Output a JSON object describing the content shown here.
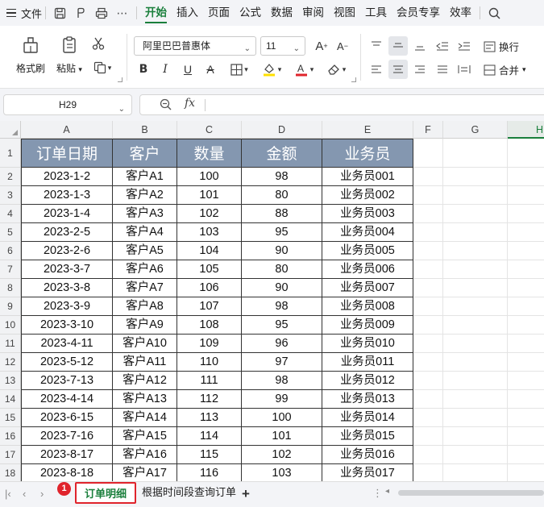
{
  "menubar": {
    "file": "文件",
    "tabs": [
      "开始",
      "插入",
      "页面",
      "公式",
      "数据",
      "审阅",
      "视图",
      "工具",
      "会员专享",
      "效率"
    ],
    "active_tab": "开始"
  },
  "ribbon": {
    "format_painter": "格式刷",
    "paste": "粘贴",
    "font_name": "阿里巴巴普惠体",
    "font_size": "11",
    "wrap": "换行",
    "merge": "合并"
  },
  "formula_bar": {
    "name_box": "H29",
    "fx": "fx",
    "value": ""
  },
  "columns": [
    "A",
    "B",
    "C",
    "D",
    "E",
    "F",
    "G",
    "H"
  ],
  "selected_column": "H",
  "rows": [
    "1",
    "2",
    "3",
    "4",
    "5",
    "6",
    "7",
    "8",
    "9",
    "10",
    "11",
    "12",
    "13",
    "14",
    "15",
    "16",
    "17",
    "18"
  ],
  "table": {
    "headers": [
      "订单日期",
      "客户",
      "数量",
      "金额",
      "业务员"
    ],
    "rows": [
      [
        "2023-1-2",
        "客户A1",
        "100",
        "98",
        "业务员001"
      ],
      [
        "2023-1-3",
        "客户A2",
        "101",
        "80",
        "业务员002"
      ],
      [
        "2023-1-4",
        "客户A3",
        "102",
        "88",
        "业务员003"
      ],
      [
        "2023-2-5",
        "客户A4",
        "103",
        "95",
        "业务员004"
      ],
      [
        "2023-2-6",
        "客户A5",
        "104",
        "90",
        "业务员005"
      ],
      [
        "2023-3-7",
        "客户A6",
        "105",
        "80",
        "业务员006"
      ],
      [
        "2023-3-8",
        "客户A7",
        "106",
        "90",
        "业务员007"
      ],
      [
        "2023-3-9",
        "客户A8",
        "107",
        "98",
        "业务员008"
      ],
      [
        "2023-3-10",
        "客户A9",
        "108",
        "95",
        "业务员009"
      ],
      [
        "2023-4-11",
        "客户A10",
        "109",
        "96",
        "业务员010"
      ],
      [
        "2023-5-12",
        "客户A11",
        "110",
        "97",
        "业务员011"
      ],
      [
        "2023-7-13",
        "客户A12",
        "111",
        "98",
        "业务员012"
      ],
      [
        "2023-4-14",
        "客户A13",
        "112",
        "99",
        "业务员013"
      ],
      [
        "2023-6-15",
        "客户A14",
        "113",
        "100",
        "业务员014"
      ],
      [
        "2023-7-16",
        "客户A15",
        "114",
        "101",
        "业务员015"
      ],
      [
        "2023-8-17",
        "客户A16",
        "115",
        "102",
        "业务员016"
      ],
      [
        "2023-8-18",
        "客户A17",
        "116",
        "103",
        "业务员017"
      ]
    ]
  },
  "sheets": {
    "badge": "1",
    "tabs": [
      "订单明细",
      "根据时间段查询订单"
    ],
    "add": "+"
  },
  "colors": {
    "accent": "#1a7f3c",
    "header_fill": "#8497b0",
    "highlight": "#e0242c"
  }
}
